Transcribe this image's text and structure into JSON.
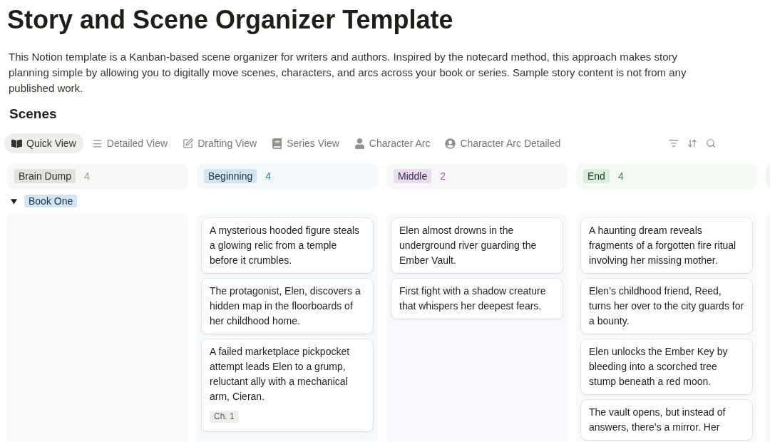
{
  "page": {
    "title": "Story and Scene Organizer Template",
    "description": "This Notion template is a Kanban-based scene organizer for writers and authors. Inspired by the notecard method, this approach makes story planning simple by allowing you to digitally move scenes, characters, and arcs across your book or series. Sample story content is not from any published work."
  },
  "board": {
    "title": "Scenes",
    "views": [
      {
        "label": "Quick View",
        "selected": true
      },
      {
        "label": "Detailed View",
        "selected": false
      },
      {
        "label": "Drafting View",
        "selected": false
      },
      {
        "label": "Series View",
        "selected": false
      },
      {
        "label": "Character Arc",
        "selected": false
      },
      {
        "label": "Character Arc Detailed",
        "selected": false
      }
    ],
    "columns": [
      {
        "label": "Brain Dump",
        "count": "4",
        "color": "#e3e2e0"
      },
      {
        "label": "Beginning",
        "count": "4",
        "color": "#d3e5ef",
        "cards": [
          {
            "text": "A mysterious hooded figure steals a glowing relic from a temple before it crumbles."
          },
          {
            "text": "The protagonist, Elen, discovers a hidden map in the floorboards of her childhood home."
          },
          {
            "text": "A failed marketplace pickpocket attempt leads Elen to a grump, reluctant ally with a mechanical arm, Cieran.",
            "tags": [
              "Ch. 1"
            ]
          }
        ]
      },
      {
        "label": "Middle",
        "count": "2",
        "color": "#e8deee",
        "cards": [
          {
            "text": "Elen almost drowns in the underground river guarding the Ember Vault."
          },
          {
            "text": "First fight with a shadow creature that whispers her deepest fears."
          }
        ]
      },
      {
        "label": "End",
        "count": "4",
        "color": "#dbeddb",
        "cards": [
          {
            "text": "A haunting dream reveals fragments of a forgotten fire ritual involving her missing mother."
          },
          {
            "text": "Elen’s childhood friend, Reed, turns her over to the city guards for a bounty."
          },
          {
            "text": "Elen unlocks the Ember Key by bleeding into a scorched tree stump beneath a red moon."
          },
          {
            "text": "The vault opens, but instead of answers, there’s a mirror. Her"
          }
        ]
      }
    ],
    "group": {
      "label": "Book One",
      "expanded": true
    }
  }
}
